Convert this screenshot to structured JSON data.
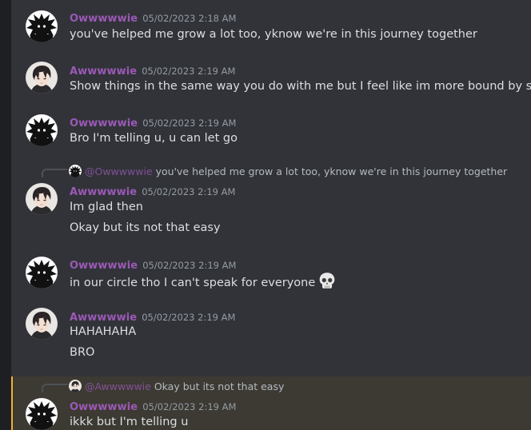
{
  "icons": {
    "user_o_avatar": "spiky-black-silhouette-avatar",
    "user_a_avatar": "anime-dark-hair-boy-avatar",
    "reply_spine": "reply-thread-connector",
    "skull_emoji": "skull-emoji"
  },
  "colors": {
    "background": "#313338",
    "username": "#9b59b6",
    "timestamp": "#949ba4",
    "text": "#dbdee1",
    "highlight_bg": "#3c3a33",
    "highlight_bar": "#f0b132"
  },
  "messages": [
    {
      "author": "Owwwwwie",
      "timestamp": "05/02/2023 2:18 AM",
      "lines": [
        "you've helped me grow a lot too, yknow we're in this journey together"
      ]
    },
    {
      "author": "Awwwwwie",
      "timestamp": "05/02/2023 2:19 AM",
      "lines": [
        "Show things in the same way you do with me but I feel like im more bound by shit"
      ]
    },
    {
      "author": "Owwwwwie",
      "timestamp": "05/02/2023 2:19 AM",
      "lines": [
        "Bro I'm telling u, u can let go"
      ]
    },
    {
      "reply": {
        "mention": "@Owwwwwie",
        "text": "you've helped me grow a lot too, yknow we're in this journey together"
      },
      "author": "Awwwwwie",
      "timestamp": "05/02/2023 2:19 AM",
      "lines": [
        "Im glad then",
        "Okay but its not that easy"
      ]
    },
    {
      "author": "Owwwwwie",
      "timestamp": "05/02/2023 2:19 AM",
      "lines": [
        "in our circle tho I can't speak for everyone"
      ]
    },
    {
      "author": "Awwwwwie",
      "timestamp": "05/02/2023 2:19 AM",
      "lines": [
        "HAHAHAHA",
        "BRO"
      ]
    },
    {
      "reply": {
        "mention": "@Awwwwwie",
        "text": "Okay but its not that easy"
      },
      "author": "Owwwwwie",
      "timestamp": "05/02/2023 2:19 AM",
      "lines": [
        "ikkk but I'm telling u"
      ]
    }
  ]
}
